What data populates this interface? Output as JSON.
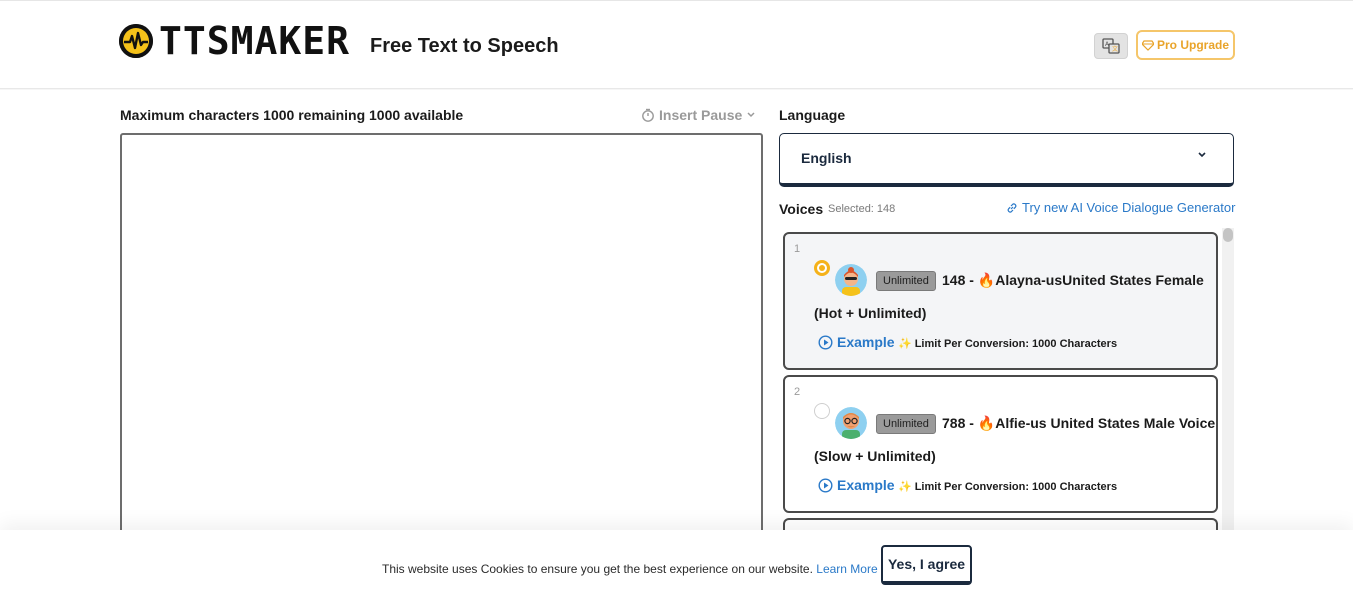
{
  "header": {
    "logo_text": "TTSMAKER",
    "tagline": "Free Text to Speech",
    "pro_label": "Pro Upgrade"
  },
  "editor": {
    "char_info": "Maximum characters 1000 remaining 1000 available",
    "insert_pause": "Insert Pause",
    "text_value": ""
  },
  "language": {
    "label": "Language",
    "selected": "English"
  },
  "voices": {
    "label": "Voices",
    "selected_text": "Selected: 148",
    "try_link": "Try new AI Voice Dialogue Generator",
    "items": [
      {
        "number": "1",
        "badge": "Unlimited",
        "title": "148 - 🔥Alayna-usUnited States Female",
        "subtitle": "(Hot + Unlimited)",
        "example": "Example",
        "limit": "Limit Per Conversion: 1000 Characters",
        "selected": true
      },
      {
        "number": "2",
        "badge": "Unlimited",
        "title": "788 - 🔥Alfie-us United States Male Voice",
        "subtitle": "(Slow + Unlimited)",
        "example": "Example",
        "limit": "Limit Per Conversion: 1000 Characters",
        "selected": false
      }
    ]
  },
  "cookie": {
    "text": "This website uses Cookies to ensure you get the best experience on our website.",
    "learn_more": "Learn More",
    "agree": "Yes, I agree"
  },
  "colors": {
    "accent_yellow": "#f5b21a",
    "link_blue": "#2a79c8",
    "navy": "#1b2a3e"
  }
}
